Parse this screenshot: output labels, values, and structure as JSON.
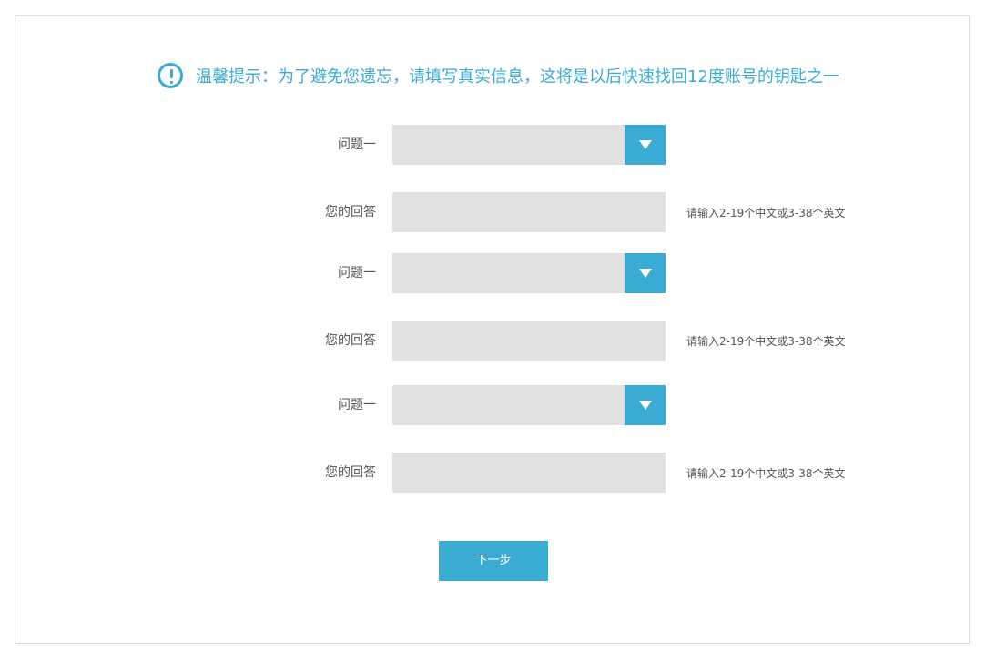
{
  "notice": {
    "icon": "exclamation-circle-icon",
    "text": "温馨提示：为了避免您遗忘，请填写真实信息，这将是以后快速找回12度账号的钥匙之一",
    "color": "#3aabd2"
  },
  "questions": [
    {
      "question_label": "问题一",
      "question_value": "",
      "answer_label": "您的回答",
      "answer_value": "",
      "hint": "请输入2-19个中文或3-38个英文"
    },
    {
      "question_label": "问题一",
      "question_value": "",
      "answer_label": "您的回答",
      "answer_value": "",
      "hint": "请输入2-19个中文或3-38个英文"
    },
    {
      "question_label": "问题一",
      "question_value": "",
      "answer_label": "您的回答",
      "answer_value": "",
      "hint": "请输入2-19个中文或3-38个英文"
    }
  ],
  "next_button": {
    "label": "下一步"
  },
  "colors": {
    "accent": "#3aabd2",
    "field_background": "#e1e1e1",
    "border": "#dcdcdc"
  }
}
